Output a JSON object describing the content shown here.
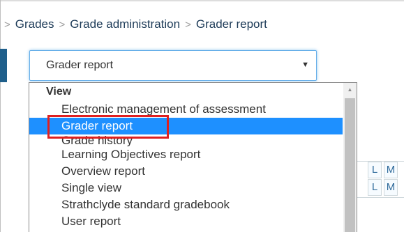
{
  "breadcrumb": {
    "items": [
      "Grades",
      "Grade administration",
      "Grader report"
    ]
  },
  "select": {
    "value": "Grader report"
  },
  "dropdown": {
    "group_label": "View",
    "options": [
      "Electronic management of assessment",
      "Grader report",
      "Grade history",
      "Learning Objectives report",
      "Overview report",
      "Single view",
      "Strathclyde standard gradebook",
      "User report"
    ],
    "selected_index": 1
  },
  "background_table": {
    "column_letters": [
      "L",
      "M"
    ]
  },
  "colors": {
    "selected_option": "#1e90ff",
    "highlight_box": "#e02020",
    "select_focus_border": "#66afe9",
    "breadcrumb_text": "#1c3a57",
    "accent_bar": "#1f5f8b"
  },
  "icons": {
    "separator": "chevron-right-icon",
    "select_arrow": "caret-down-icon",
    "scroll_up": "scroll-up-arrow-icon"
  }
}
